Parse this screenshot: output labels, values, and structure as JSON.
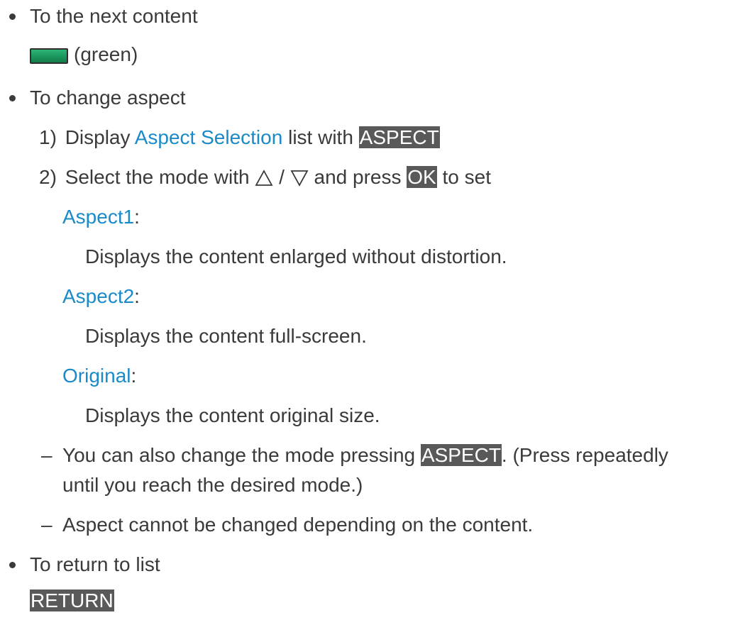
{
  "items": {
    "next_content": {
      "label": "To the next content",
      "button_text": "(green)",
      "button_color": "#1c9c60"
    },
    "change_aspect": {
      "label": "To change aspect",
      "step1": {
        "num": "1)",
        "pre": "Display",
        "link": "Aspect Selection",
        "mid": "list with",
        "key": "ASPECT"
      },
      "step2": {
        "num": "2)",
        "pre": "Select the mode with",
        "sep": "/",
        "mid": "and press",
        "key": "OK",
        "post": "to set",
        "up_icon": "up-triangle-icon",
        "down_icon": "down-triangle-icon"
      },
      "modes": [
        {
          "name": "Aspect1",
          "colon": ":",
          "desc": "Displays the content enlarged without distortion."
        },
        {
          "name": "Aspect2",
          "colon": ":",
          "desc": "Displays the content full-screen."
        },
        {
          "name": "Original",
          "colon": ":",
          "desc": "Displays the content original size."
        }
      ],
      "notes": [
        {
          "dash": "–",
          "pre": "You can also change the mode pressing",
          "key": "ASPECT",
          "post": ". (Press repeatedly",
          "cont": "until you reach the desired mode.)"
        },
        {
          "dash": "–",
          "text": "Aspect cannot be changed depending on the content."
        }
      ]
    },
    "return_list": {
      "label": "To return to list",
      "key": "RETURN"
    }
  },
  "colors": {
    "text": "#3a3a3a",
    "link": "#1a8ac9",
    "key_bg": "#595959",
    "key_text": "#ffffff"
  }
}
